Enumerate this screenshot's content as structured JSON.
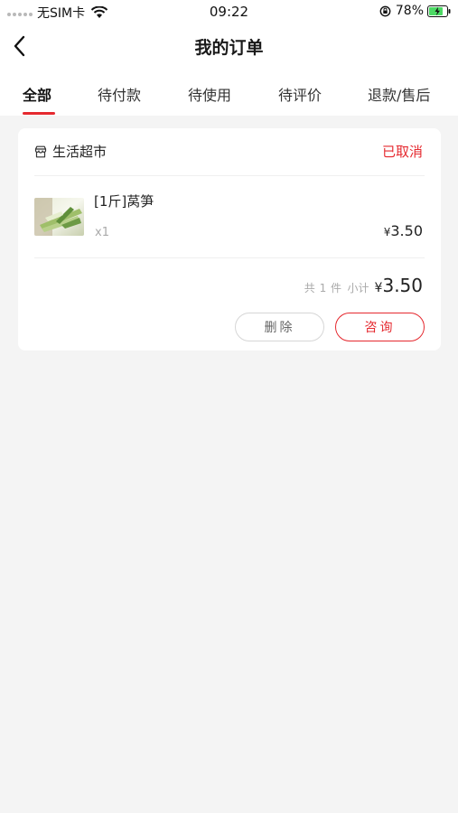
{
  "status_bar": {
    "carrier": "无SIM卡",
    "time": "09:22",
    "battery": "78%"
  },
  "nav": {
    "title": "我的订单",
    "back_icon": "chevron-left-icon"
  },
  "tabs": [
    {
      "label": "全部",
      "active": true
    },
    {
      "label": "待付款",
      "active": false
    },
    {
      "label": "待使用",
      "active": false
    },
    {
      "label": "待评价",
      "active": false
    },
    {
      "label": "退款/售后",
      "active": false
    }
  ],
  "order": {
    "shop_icon": "store-icon",
    "shop_name": "生活超市",
    "status": "已取消",
    "item": {
      "name": "[1斤]莴笋",
      "quantity": "x1",
      "currency": "¥",
      "price": "3.50"
    },
    "summary": {
      "count_text": "共 1 件",
      "subtotal_label": "小计",
      "currency": "¥",
      "total": "3.50"
    },
    "actions": {
      "delete": "删除",
      "consult": "咨询"
    }
  },
  "colors": {
    "accent": "#e5292f",
    "background": "#f4f4f4",
    "card": "#ffffff"
  }
}
